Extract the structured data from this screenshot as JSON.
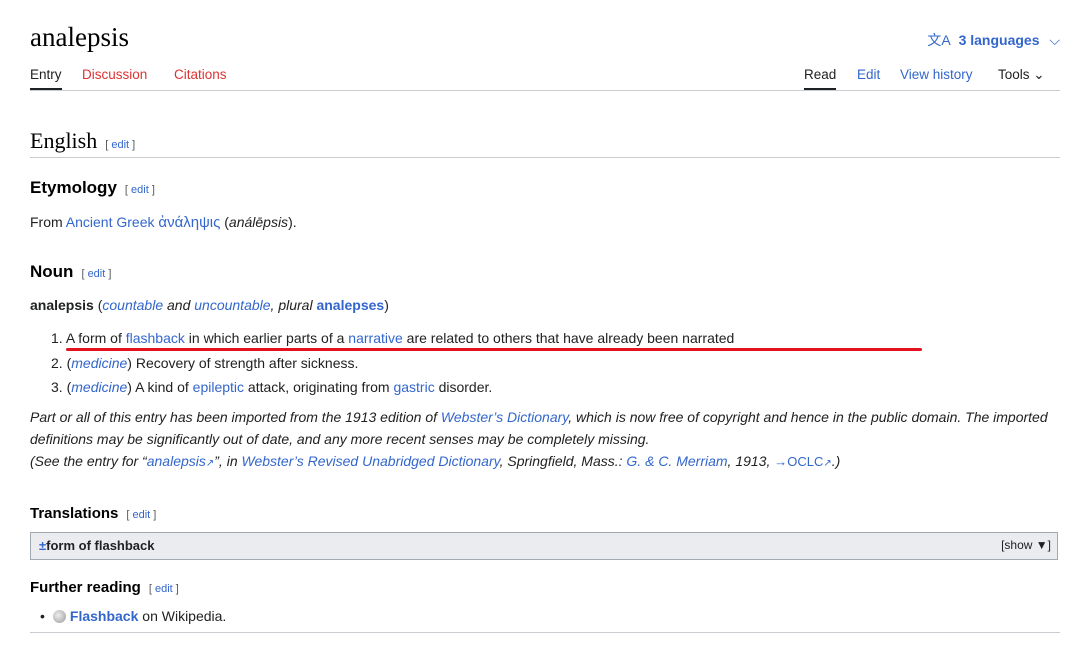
{
  "page": {
    "title": "analepsis",
    "languages_label": "3 languages"
  },
  "tabs": {
    "entry": "Entry",
    "discussion": "Discussion",
    "citations": "Citations",
    "read": "Read",
    "edit": "Edit",
    "history": "View history",
    "tools": "Tools"
  },
  "edit_label": "edit",
  "english": {
    "heading": "English"
  },
  "etymology": {
    "heading": "Etymology",
    "pre": "From ",
    "link": "Ancient Greek",
    "greek": "ἀνάληψις",
    "open": " (",
    "translit": "análēpsis",
    "close": ")."
  },
  "noun": {
    "heading": "Noun",
    "headword": "analepsis",
    "countable": "countable",
    "and": " and ",
    "uncountable": "uncountable",
    "plural_word": ", plural ",
    "plural": "analepses",
    "definitions": [
      {
        "num": "1.",
        "a": "A form of ",
        "l1": "flashback",
        "b": " in which earlier parts of a ",
        "l2": "narrative",
        "c": " are related to others that have already been narrated"
      },
      {
        "num": "2.",
        "label": "medicine",
        "text": " Recovery of strength after sickness."
      },
      {
        "num": "3.",
        "label": "medicine",
        "a": " A kind of ",
        "l1": "epileptic",
        "b": " attack, originating from ",
        "l2": "gastric",
        "c": " disorder."
      }
    ]
  },
  "notice": {
    "t1": "Part or all of this entry has been imported from the 1913 edition of ",
    "l1": "Webster’s Dictionary",
    "t2": ", which is now free of copyright and hence in the public domain. The imported definitions may be significantly out of date, and any more recent senses may be completely missing.",
    "t3": "(See the entry for “",
    "l2": "analepsis",
    "t4": "”, in ",
    "l3": "Webster’s Revised Unabridged Dictionary",
    "t5": ", Springfield, Mass.: ",
    "l4": "G. & C. Merriam",
    "t6": ", 1913, ",
    "l5": "→OCLC",
    "t7": ".)"
  },
  "translations": {
    "heading": "Translations",
    "pm": "±",
    "label": "form of flashback",
    "show": "[show ▼]"
  },
  "further": {
    "heading": "Further reading",
    "link": "Flashback",
    "rest": " on Wikipedia."
  }
}
